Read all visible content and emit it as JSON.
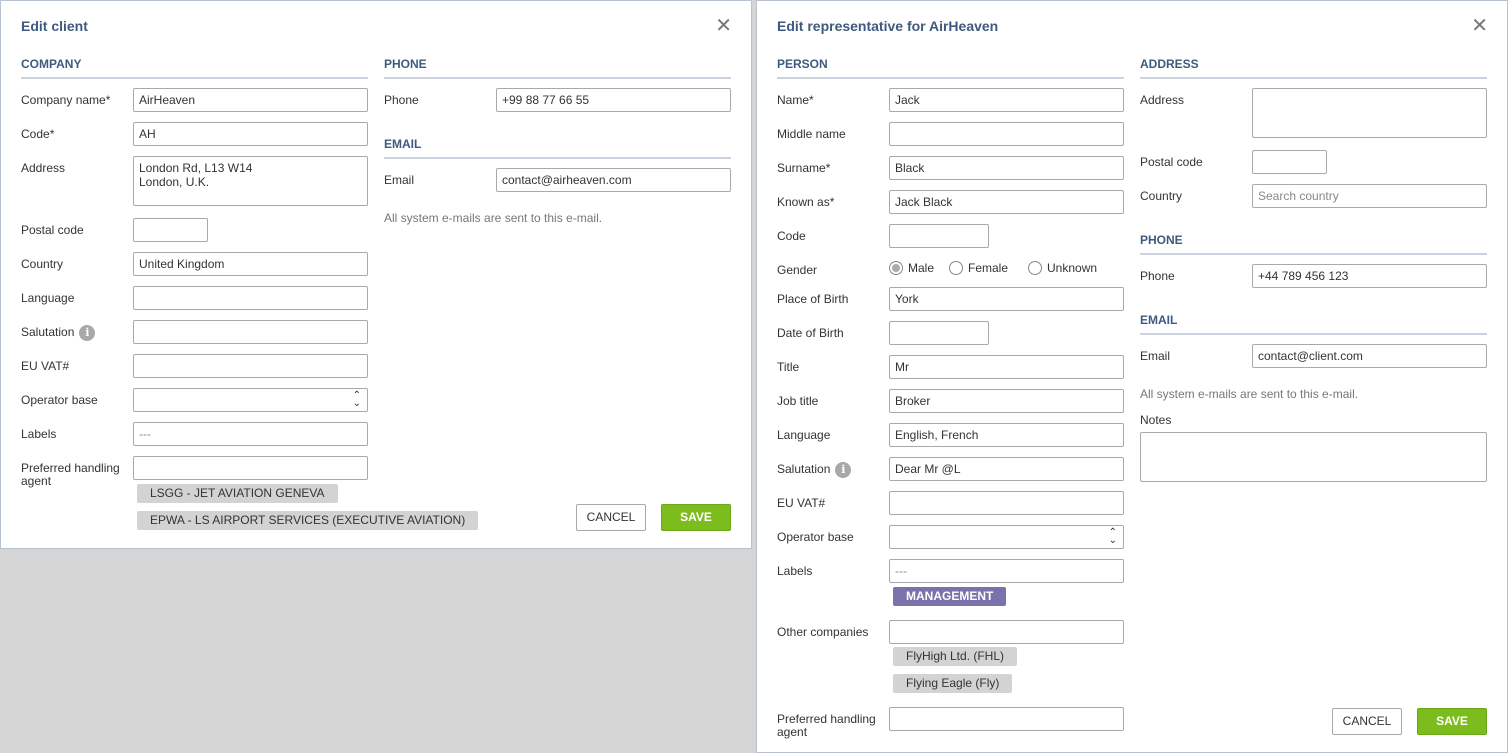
{
  "client": {
    "title": "Edit client",
    "close": "✕",
    "company_section": "COMPANY",
    "phone_section": "PHONE",
    "email_section": "EMAIL",
    "labels": {
      "company_name": "Company name*",
      "code": "Code*",
      "address": "Address",
      "postal_code": "Postal code",
      "country": "Country",
      "language": "Language",
      "salutation": "Salutation",
      "eu_vat": "EU VAT#",
      "operator_base": "Operator base",
      "labels": "Labels",
      "preferred_handling_agent": "Preferred handling agent",
      "phone": "Phone",
      "email": "Email"
    },
    "values": {
      "company_name": "AirHeaven",
      "code": "AH",
      "address": "London Rd, L13 W14\nLondon, U.K.",
      "postal_code": "",
      "country": "United Kingdom",
      "language": "",
      "salutation": "",
      "eu_vat": "",
      "operator_base": "---",
      "labels": "---",
      "preferred_handling_agent": "",
      "phone": "+99 88 77 66 55",
      "email": "contact@airheaven.com"
    },
    "agents": [
      "LSGG - JET AVIATION GENEVA",
      "EPWA - LS AIRPORT SERVICES (EXECUTIVE AVIATION)"
    ],
    "email_hint": "All system e-mails are sent to this e-mail.",
    "cancel": "CANCEL",
    "save": "SAVE"
  },
  "rep": {
    "title": "Edit representative for AirHeaven",
    "close": "✕",
    "person_section": "PERSON",
    "address_section": "ADDRESS",
    "phone_section": "PHONE",
    "email_section": "EMAIL",
    "labels": {
      "name": "Name*",
      "middle_name": "Middle name",
      "surname": "Surname*",
      "known_as": "Known as*",
      "code": "Code",
      "gender": "Gender",
      "place_of_birth": "Place of Birth",
      "date_of_birth": "Date of Birth",
      "title": "Title",
      "job_title": "Job title",
      "language": "Language",
      "salutation": "Salutation",
      "eu_vat": "EU VAT#",
      "operator_base": "Operator base",
      "labels": "Labels",
      "other_companies": "Other companies",
      "preferred_handling_agent": "Preferred handling agent",
      "address": "Address",
      "postal_code": "Postal code",
      "country": "Country",
      "phone": "Phone",
      "email": "Email",
      "notes": "Notes"
    },
    "values": {
      "name": "Jack",
      "middle_name": "",
      "surname": "Black",
      "known_as": "Jack Black",
      "code": "",
      "place_of_birth": "York",
      "date_of_birth": "",
      "title": "Mr",
      "job_title": "Broker",
      "language": "English, French",
      "salutation": "Dear Mr @L",
      "eu_vat": "",
      "operator_base": "---",
      "labels": "---",
      "other_companies": "",
      "preferred_handling_agent": "",
      "address": "",
      "postal_code": "",
      "phone": "+44 789 456 123",
      "email": "contact@client.com",
      "notes": ""
    },
    "country_placeholder": "Search country",
    "gender_options": [
      "Male",
      "Female",
      "Unknown"
    ],
    "gender_selected": "Male",
    "label_tags": [
      "MANAGEMENT"
    ],
    "company_tags": [
      "FlyHigh Ltd. (FHL)",
      "Flying Eagle (Fly)"
    ],
    "email_hint": "All system e-mails are sent to this e-mail.",
    "cancel": "CANCEL",
    "save": "SAVE"
  },
  "icons": {
    "info": "info-icon",
    "close": "close-icon",
    "select_arrows": "chevron-updown-icon"
  },
  "colors": {
    "title": "#3e5a7e",
    "save": "#7cbd1d",
    "label_tag": "#7a72aa",
    "chip": "#d3d3d3"
  }
}
